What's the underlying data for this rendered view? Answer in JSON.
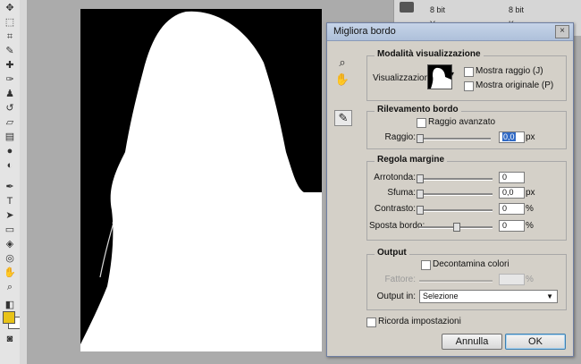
{
  "info_panel": {
    "r1_left": "8 bit",
    "r1_right": "8 bit",
    "r2_k": "K:",
    "r2_y": "Y:"
  },
  "dialog": {
    "title": "Migliora bordo",
    "close_glyph": "×",
    "view_mode": {
      "title": "Modalità visualizzazione",
      "label": "Visualizzazione:",
      "show_radius": "Mostra raggio (J)",
      "show_original": "Mostra originale (P)"
    },
    "edge_detection": {
      "title": "Rilevamento bordo",
      "smart_radius": "Raggio avanzato",
      "radius_label": "Raggio:",
      "radius_value": "0,0",
      "radius_unit": "px"
    },
    "adjust_edge": {
      "title": "Regola margine",
      "rows": [
        {
          "label": "Arrotonda:",
          "value": "0",
          "unit": "",
          "level": 0
        },
        {
          "label": "Sfuma:",
          "value": "0,0",
          "unit": "px",
          "level": 0
        },
        {
          "label": "Contrasto:",
          "value": "0",
          "unit": "%",
          "level": 0
        },
        {
          "label": "Sposta bordo:",
          "value": "0",
          "unit": "%",
          "level": 0.5
        }
      ]
    },
    "output": {
      "title": "Output",
      "decontaminate": "Decontamina colori",
      "amount_label": "Fattore:",
      "amount_unit": "%",
      "output_to_label": "Output in:",
      "output_to_value": "Selezione"
    },
    "remember": "Ricorda impostazioni",
    "cancel": "Annulla",
    "ok": "OK"
  }
}
